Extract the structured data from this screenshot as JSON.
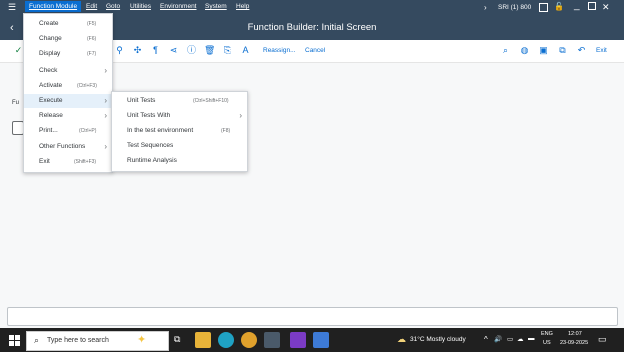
{
  "menubar": {
    "items": [
      "Function Module",
      "Edit",
      "Goto",
      "Utilities",
      "Environment",
      "System",
      "Help"
    ],
    "system_info": "SRI (1) 800"
  },
  "title": "Function Builder: Initial Screen",
  "toolbar": {
    "reassign": "Reassign...",
    "cancel": "Cancel",
    "exit": "Exit"
  },
  "main": {
    "field_label_fragment": "Fu"
  },
  "function_module_menu": [
    {
      "label": "Create",
      "shortcut": "(F5)",
      "submenu": false
    },
    {
      "label": "Change",
      "shortcut": "(F6)",
      "submenu": false
    },
    {
      "label": "Display",
      "shortcut": "(F7)",
      "submenu": false
    },
    {
      "label": "Check",
      "shortcut": "",
      "submenu": true
    },
    {
      "label": "Activate",
      "shortcut": "(Ctrl+F3)",
      "submenu": false
    },
    {
      "label": "Execute",
      "shortcut": "",
      "submenu": true
    },
    {
      "label": "Release",
      "shortcut": "",
      "submenu": true
    },
    {
      "label": "Print...",
      "shortcut": "(Ctrl+P)",
      "submenu": false
    },
    {
      "label": "Other Functions",
      "shortcut": "",
      "submenu": true
    },
    {
      "label": "Exit",
      "shortcut": "(Shift+F3)",
      "submenu": false
    }
  ],
  "execute_submenu": [
    {
      "label": "Unit Tests",
      "shortcut": "(Ctrl+Shift+F10)",
      "submenu": false
    },
    {
      "label": "Unit Tests With",
      "shortcut": "",
      "submenu": true
    },
    {
      "label": "In the test environment",
      "shortcut": "(F8)",
      "submenu": false
    },
    {
      "label": "Test Sequences",
      "shortcut": "",
      "submenu": false
    },
    {
      "label": "Runtime Analysis",
      "shortcut": "",
      "submenu": false
    }
  ],
  "taskbar": {
    "search_placeholder": "Type here to search",
    "weather": "31°C  Mostly cloudy",
    "lang_top": "ENG",
    "lang_bottom": "US",
    "time": "12:07",
    "date": "23-09-2025"
  },
  "colors": {
    "shell_header": "#354a5f",
    "accent": "#0a6ed1",
    "taskbar": "#202020"
  }
}
